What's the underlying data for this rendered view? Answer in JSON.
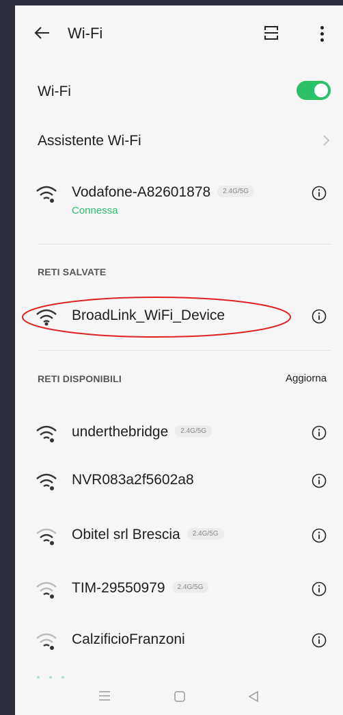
{
  "header": {
    "title": "Wi-Fi",
    "back_icon": "arrow-left-icon",
    "scan_icon": "qr-scan-icon",
    "more_icon": "more-vertical-icon"
  },
  "wifi_toggle": {
    "label": "Wi-Fi",
    "enabled": true,
    "accent": "#2cc069"
  },
  "assistant": {
    "label": "Assistente Wi-Fi"
  },
  "connected": {
    "name": "Vodafone-A82601878",
    "band": "2.4G/5G",
    "status": "Connessa"
  },
  "saved": {
    "heading": "RETI SALVATE",
    "networks": [
      {
        "name": "BroadLink_WiFi_Device"
      }
    ]
  },
  "available": {
    "heading": "RETI DISPONIBILI",
    "refresh_label": "Aggiorna",
    "networks": [
      {
        "name": "underthebridge",
        "band": "2.4G/5G"
      },
      {
        "name": "NVR083a2f5602a8",
        "band": ""
      },
      {
        "name": "Obitel srl Brescia",
        "band": "2.4G/5G"
      },
      {
        "name": "TIM-29550979",
        "band": "2.4G/5G"
      },
      {
        "name": "CalzificioFranzoni",
        "band": ""
      }
    ]
  },
  "nav": {
    "menu_icon": "menu-icon",
    "home_icon": "home-square-icon",
    "back_icon": "back-triangle-icon"
  },
  "colors": {
    "accent": "#2cc069",
    "highlight": "#e02020",
    "background": "#f6f6f6",
    "frame": "#2e2d3b"
  }
}
